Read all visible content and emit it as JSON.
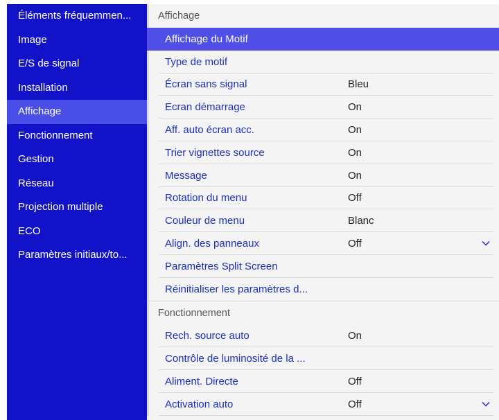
{
  "sidebar": {
    "items": [
      {
        "label": "Éléments fréquemmen...",
        "active": false
      },
      {
        "label": "Image",
        "active": false
      },
      {
        "label": "E/S de signal",
        "active": false
      },
      {
        "label": "Installation",
        "active": false
      },
      {
        "label": "Affichage",
        "active": true
      },
      {
        "label": "Fonctionnement",
        "active": false
      },
      {
        "label": "Gestion",
        "active": false
      },
      {
        "label": "Réseau",
        "active": false
      },
      {
        "label": "Projection multiple",
        "active": false
      },
      {
        "label": "ECO",
        "active": false
      },
      {
        "label": "Paramètres initiaux/to...",
        "active": false
      }
    ]
  },
  "main": {
    "sections": [
      {
        "title": "Affichage",
        "rows": [
          {
            "label": "Affichage du Motif",
            "value": "",
            "selected": true
          },
          {
            "label": "Type de motif",
            "value": ""
          },
          {
            "label": "Écran sans signal",
            "value": "Bleu"
          },
          {
            "label": "Ecran démarrage",
            "value": "On"
          },
          {
            "label": "Aff. auto écran acc.",
            "value": "On"
          },
          {
            "label": "Trier vignettes source",
            "value": "On"
          },
          {
            "label": "Message",
            "value": "On"
          },
          {
            "label": "Rotation du menu",
            "value": "Off"
          },
          {
            "label": "Couleur de menu",
            "value": "Blanc"
          },
          {
            "label": "Align. des panneaux",
            "value": "Off",
            "dropdown": true
          },
          {
            "label": "Paramètres Split Screen",
            "value": ""
          },
          {
            "label": "Réinitialiser les paramètres d...",
            "value": ""
          }
        ]
      },
      {
        "title": "Fonctionnement",
        "rows": [
          {
            "label": "Rech. source auto",
            "value": "On"
          },
          {
            "label": "Contrôle de luminosité de la ...",
            "value": ""
          },
          {
            "label": "Aliment. Directe",
            "value": "Off"
          },
          {
            "label": "Activation auto",
            "value": "Off",
            "dropdown": true
          }
        ]
      }
    ]
  },
  "colors": {
    "sidebar_bg": "#1212c8",
    "sidebar_active": "#4a4ee8",
    "selected_row": "#5050e8",
    "label_text": "#1a2fb8",
    "chevron": "#3a3ad8"
  },
  "icons": {
    "dropdown": "chevron-down-icon"
  }
}
